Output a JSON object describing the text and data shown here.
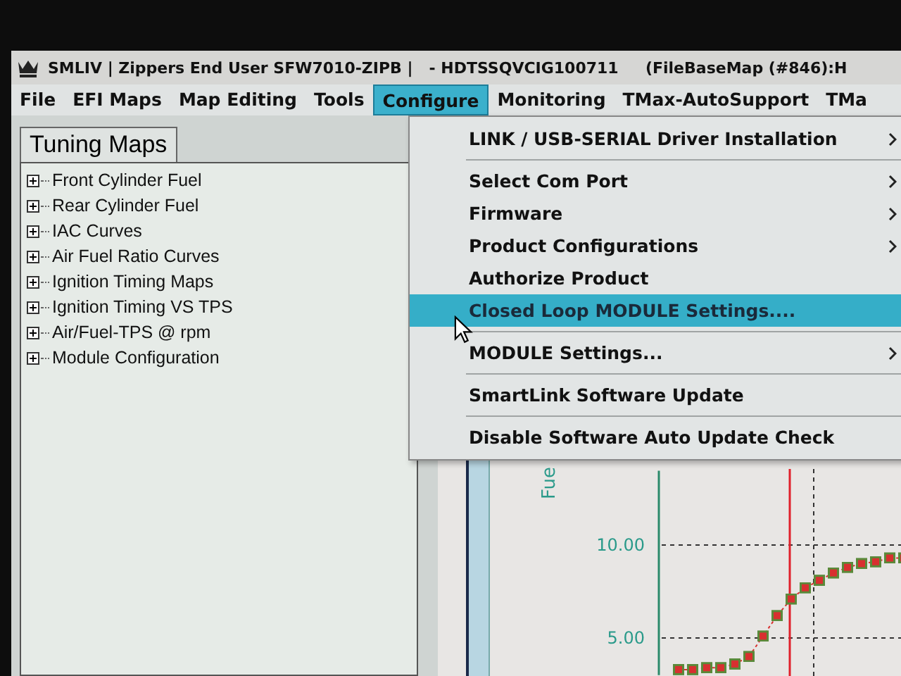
{
  "window": {
    "title": "SMLIV | Zippers End User SFW7010-ZIPB |   - HDTSSQVCIG100711     (FileBaseMap (#846):H"
  },
  "menu_bar": [
    {
      "label": "File",
      "selected": false
    },
    {
      "label": "EFI Maps",
      "selected": false
    },
    {
      "label": "Map Editing",
      "selected": false
    },
    {
      "label": "Tools",
      "selected": false
    },
    {
      "label": "Configure",
      "selected": true
    },
    {
      "label": "Monitoring",
      "selected": false
    },
    {
      "label": "TMax-AutoSupport",
      "selected": false
    },
    {
      "label": "TMa",
      "selected": false
    }
  ],
  "left_panel": {
    "tab": "Tuning Maps",
    "tree": [
      {
        "label": "Front Cylinder Fuel",
        "expanded": false
      },
      {
        "label": "Rear Cylinder Fuel",
        "expanded": false
      },
      {
        "label": "IAC Curves",
        "expanded": false
      },
      {
        "label": "Air Fuel Ratio Curves",
        "expanded": false
      },
      {
        "label": "Ignition Timing Maps",
        "expanded": false
      },
      {
        "label": "Ignition Timing VS TPS",
        "expanded": false
      },
      {
        "label": "Air/Fuel-TPS @ rpm",
        "expanded": false
      },
      {
        "label": "Module Configuration",
        "expanded": false
      }
    ]
  },
  "configure_menu": [
    {
      "kind": "item",
      "label": "LINK / USB-SERIAL Driver Installation",
      "submenu": true,
      "selected": false
    },
    {
      "kind": "separator"
    },
    {
      "kind": "item",
      "label": "Select Com Port",
      "submenu": true,
      "selected": false
    },
    {
      "kind": "item",
      "label": "Firmware",
      "submenu": true,
      "selected": false
    },
    {
      "kind": "item",
      "label": "Product Configurations",
      "submenu": true,
      "selected": false
    },
    {
      "kind": "item",
      "label": "Authorize Product",
      "submenu": false,
      "selected": false
    },
    {
      "kind": "item",
      "label": "Closed Loop MODULE Settings....",
      "submenu": false,
      "selected": true
    },
    {
      "kind": "separator"
    },
    {
      "kind": "item",
      "label": "MODULE Settings...",
      "submenu": true,
      "selected": false
    },
    {
      "kind": "separator"
    },
    {
      "kind": "item",
      "label": "SmartLink Software Update",
      "submenu": false,
      "selected": false
    },
    {
      "kind": "separator"
    },
    {
      "kind": "item",
      "label": "Disable Software Auto Update Check",
      "submenu": false,
      "selected": false
    }
  ],
  "chart": {
    "chart_data": {
      "type": "line",
      "ylabel": "Fue",
      "ylim": [
        3,
        14
      ],
      "yticks": [
        {
          "value": 5,
          "label": "5.00"
        },
        {
          "value": 10,
          "label": "10.00"
        }
      ],
      "series": [
        {
          "color": "#d83030",
          "line_style": "dotted",
          "values": [
            3.3,
            3.3,
            3.4,
            3.4,
            3.6,
            4.0,
            5.1,
            6.2,
            7.1,
            7.7,
            8.1,
            8.5,
            8.8,
            9.0,
            9.1,
            9.3,
            9.3
          ]
        }
      ]
    }
  }
}
